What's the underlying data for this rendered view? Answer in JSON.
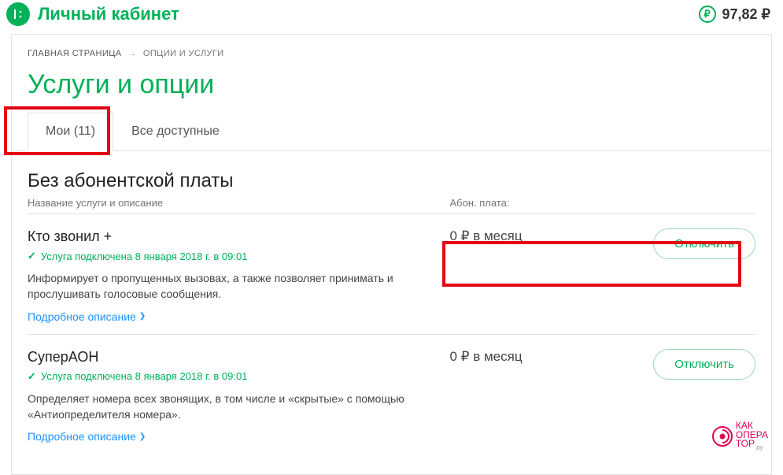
{
  "header": {
    "brand": "Личный кабинет",
    "balance": "97,82 ₽",
    "currency_symbol": "₽"
  },
  "breadcrumb": {
    "home": "ГЛАВНАЯ СТРАНИЦА",
    "arrow": "→",
    "current": "ОПЦИИ И УСЛУГИ"
  },
  "page_title": "Услуги и опции",
  "tabs": {
    "mine": "Мои (11)",
    "available": "Все доступные"
  },
  "section": {
    "title": "Без абонентской платы",
    "col_name": "Название услуги и описание",
    "col_fee": "Абон. плата:"
  },
  "services": [
    {
      "name": "Кто звонил +",
      "status": "Услуга подключена 8 января 2018 г. в 09:01",
      "desc": "Информирует о пропущенных вызовах, а также позволяет принимать и прослушивать голосовые сообщения.",
      "details": "Подробное описание",
      "price": "0 ₽ в месяц",
      "action": "Отключить"
    },
    {
      "name": "СуперАОН",
      "status": "Услуга подключена 8 января 2018 г. в 09:01",
      "desc": "Определяет номера всех звонящих, в том числе и «скрытые» с помощью «Антиопределителя номера».",
      "details": "Подробное описание",
      "price": "0 ₽ в месяц",
      "action": "Отключить"
    }
  ],
  "watermark": {
    "line1": "КАК",
    "line2": "ОПЕРА",
    "line3": "ТОР",
    "suffix": ".ру"
  },
  "colors": {
    "green": "#00b058",
    "red": "#e30613",
    "blue": "#1e90ff"
  }
}
